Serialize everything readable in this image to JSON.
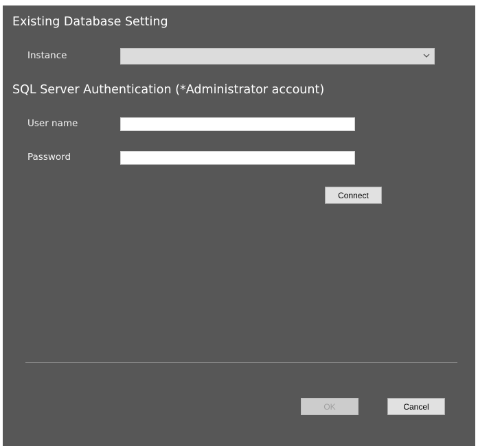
{
  "dialog": {
    "existing_section_title": "Existing Database Setting",
    "instance": {
      "label": "Instance",
      "value": "",
      "arrow_icon": "chevron-down-icon"
    },
    "auth_section_title": "SQL Server Authentication (*Administrator account)",
    "username": {
      "label": "User name",
      "value": ""
    },
    "password": {
      "label": "Password",
      "value": ""
    },
    "connect_label": "Connect",
    "ok_label": "OK",
    "cancel_label": "Cancel"
  },
  "colors": {
    "dialog_background": "#575757",
    "text": "#ffffff",
    "disabled_button": "#cccccc"
  }
}
